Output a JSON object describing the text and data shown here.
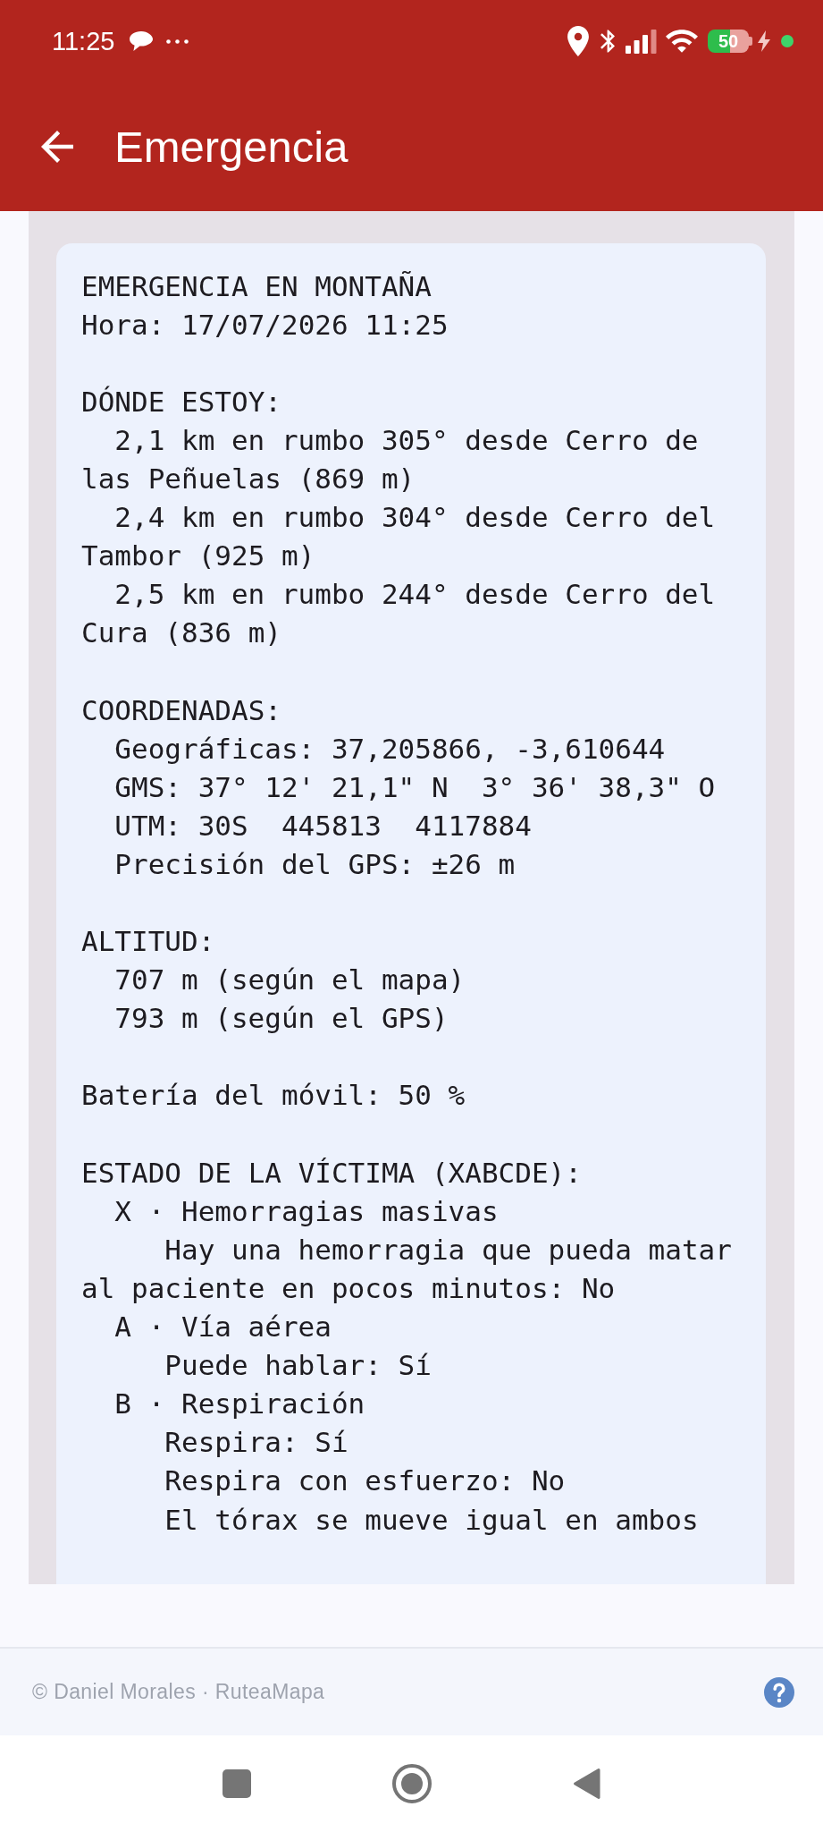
{
  "status_bar": {
    "time": "11:25",
    "battery": "50"
  },
  "app_bar": {
    "title": "Emergencia"
  },
  "report": {
    "sections": [
      {
        "lines": [
          "EMERGENCIA EN MONTAÑA",
          "Hora: 17/07/2026 11:25"
        ]
      },
      {
        "lines": [
          "DÓNDE ESTOY:"
        ],
        "items": [
          {
            "text": "2,1 km en rumbo 305° desde Cerro de las Peñuelas (869 m)"
          },
          {
            "text": "2,4 km en rumbo 304° desde Cerro del Tambor (925 m)"
          },
          {
            "text": "2,5 km en rumbo 244° desde Cerro del Cura (836 m)"
          }
        ]
      },
      {
        "lines": [
          "COORDENADAS:"
        ],
        "items": [
          {
            "text": "Geográficas: 37,205866, -3,610644"
          },
          {
            "text": "GMS: 37° 12' 21,1\" N  3° 36' 38,3\" O"
          },
          {
            "text": "UTM: 30S  445813  4117884"
          },
          {
            "text": "Precisión del GPS: ±26 m"
          }
        ]
      },
      {
        "lines": [
          "ALTITUD:"
        ],
        "items": [
          {
            "text": "707 m (según el mapa)"
          },
          {
            "text": "793 m (según el GPS)"
          }
        ]
      },
      {
        "lines": [
          "Batería del móvil: 50 %"
        ]
      },
      {
        "lines": [
          "ESTADO DE LA VÍCTIMA (XABCDE):"
        ],
        "items": [
          {
            "text": "X · Hemorragias masivas",
            "children": [
              {
                "text": "Hay una hemorragia que pueda matar al paciente en pocos minutos: No"
              }
            ]
          },
          {
            "text": "A · Vía aérea",
            "children": [
              {
                "text": "Puede hablar: Sí"
              }
            ]
          },
          {
            "text": "B · Respiración",
            "children": [
              {
                "text": "Respira: Sí"
              },
              {
                "text": "Respira con esfuerzo: No"
              },
              {
                "text": "El tórax se mueve igual en ambos"
              }
            ]
          }
        ]
      }
    ]
  },
  "footer": {
    "credit": "© Daniel Morales · RuteaMapa"
  }
}
